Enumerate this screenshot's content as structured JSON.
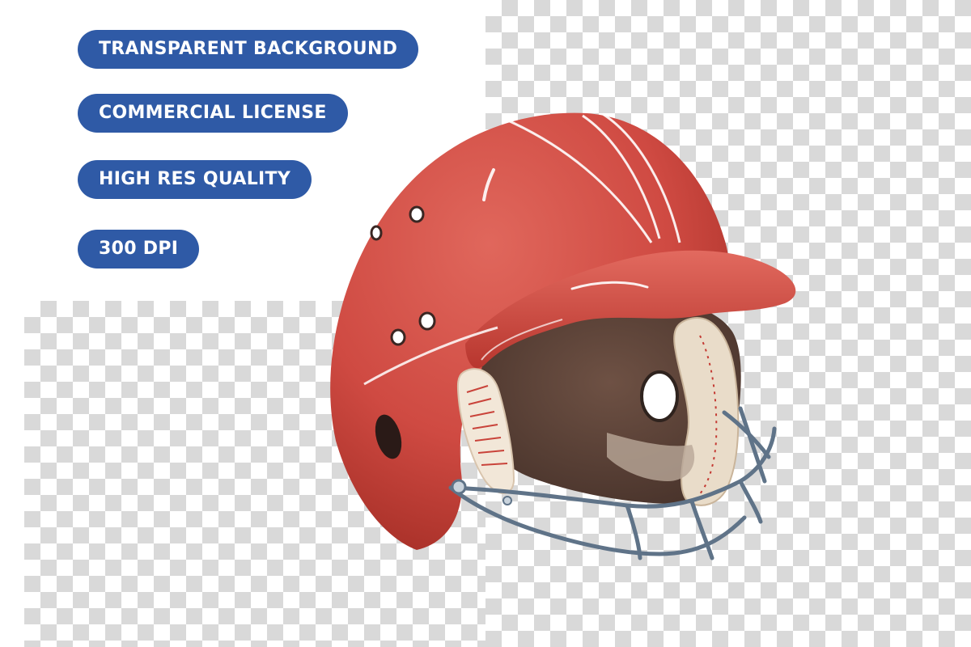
{
  "badges": [
    {
      "label": "TRANSPARENT BACKGROUND"
    },
    {
      "label": "COMMERCIAL LICENSE"
    },
    {
      "label": "HIGH RES QUALITY"
    },
    {
      "label": "300 DPI"
    }
  ],
  "image": {
    "subject": "helmet-illustration",
    "icon": "helmet-icon"
  },
  "colors": {
    "badge_background": "#2f5aa6",
    "badge_text": "#ffffff",
    "helmet_red": "#d04a43",
    "helmet_dark": "#a83028",
    "lining_brown": "#5c4236",
    "facemask_steel": "#5f7388",
    "checker_gray": "#d9d9d9"
  }
}
